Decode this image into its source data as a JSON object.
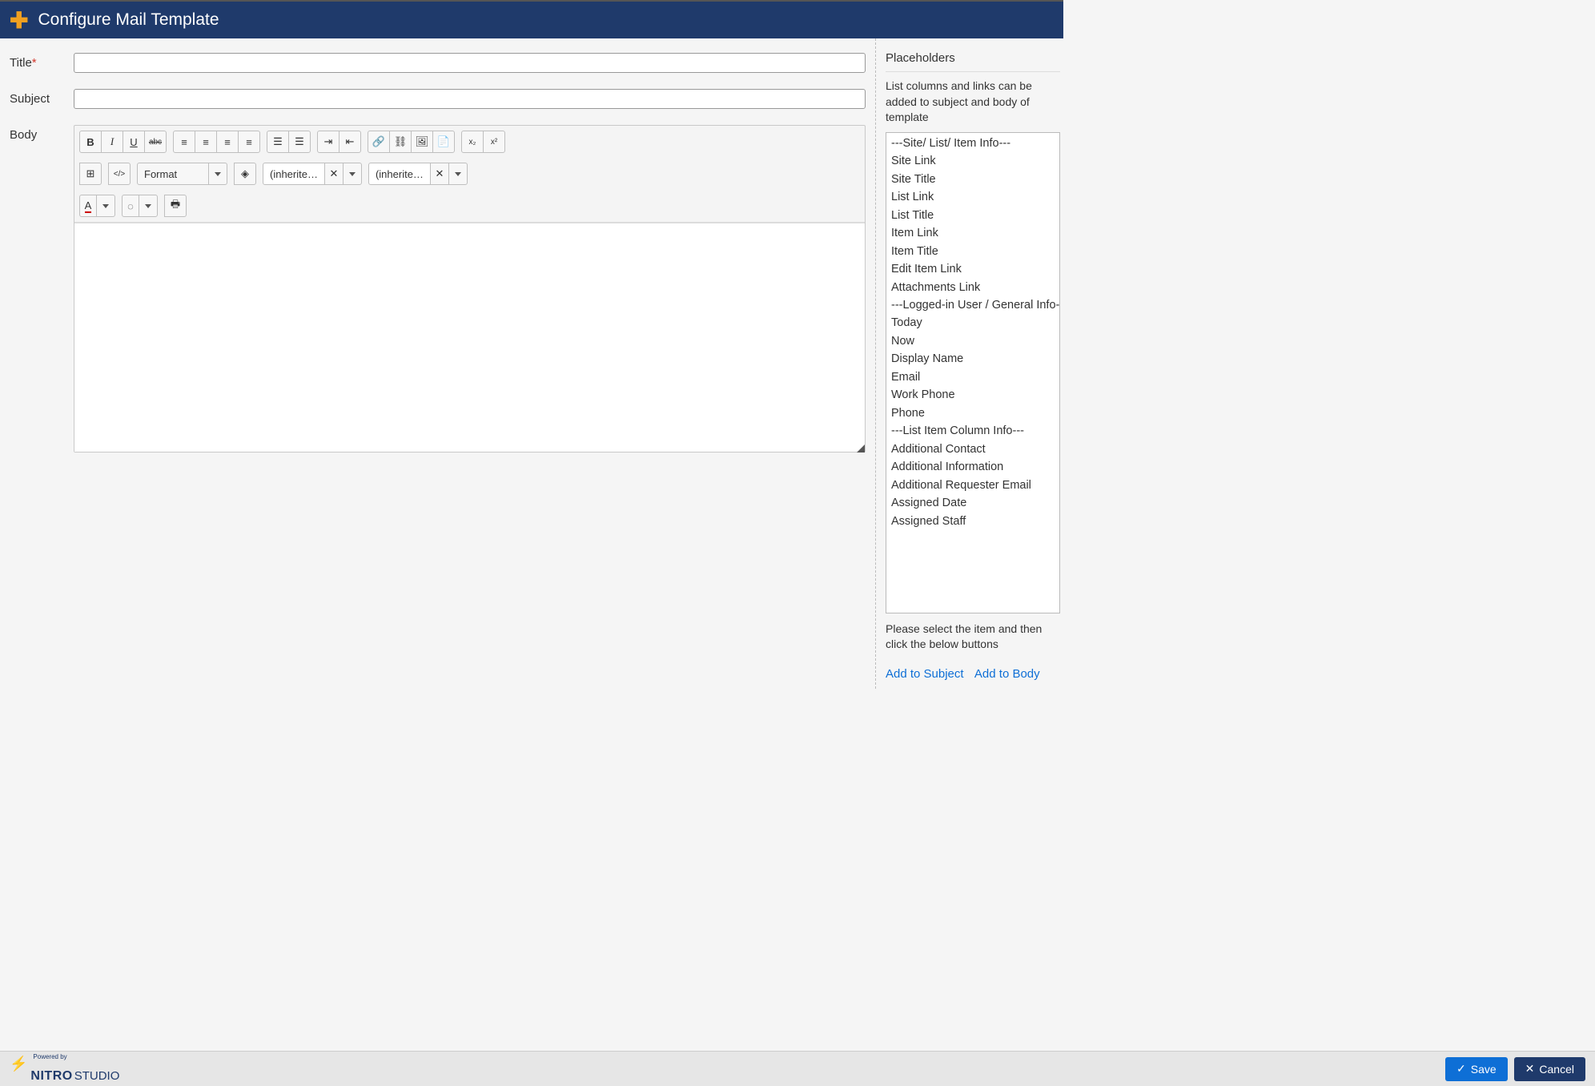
{
  "header": {
    "title": "Configure Mail Template"
  },
  "form": {
    "title_label": "Title",
    "subject_label": "Subject",
    "body_label": "Body",
    "title_value": "",
    "subject_value": ""
  },
  "toolbar": {
    "format_label": "Format",
    "inherit_font_label": "(inherite…",
    "inherit_size_label": "(inherite…"
  },
  "sidebar": {
    "heading": "Placeholders",
    "description": "List columns and links can be added to subject and body of template",
    "items": [
      "---Site/ List/ Item Info---",
      "Site Link",
      "Site Title",
      "List Link",
      "List Title",
      "Item Link",
      "Item Title",
      "Edit Item Link",
      "Attachments Link",
      "---Logged-in User / General Info---",
      "Today",
      "Now",
      "Display Name",
      "Email",
      "Work Phone",
      "Phone",
      "---List Item Column Info---",
      "Additional Contact",
      "Additional Information",
      "Additional Requester Email",
      "Assigned Date",
      "Assigned Staff"
    ],
    "instruction": "Please select the item and then click the below buttons",
    "add_subject_label": "Add to Subject",
    "add_body_label": "Add to Body"
  },
  "footer": {
    "powered_by": "Powered by",
    "brand_bold": "NITRO",
    "brand_light": "STUDIO",
    "save_label": "Save",
    "cancel_label": "Cancel"
  }
}
